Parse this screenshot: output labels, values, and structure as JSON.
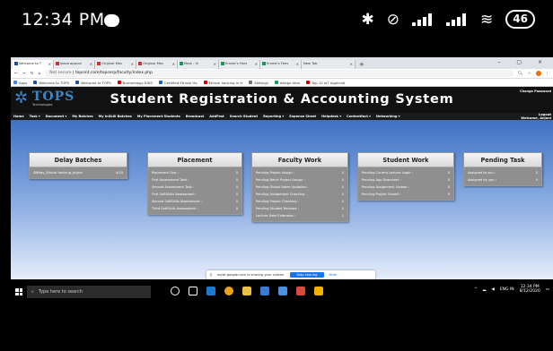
{
  "phone": {
    "time": "12:34 PM",
    "battery": "46"
  },
  "browser": {
    "tabs": [
      "Welcome to T",
      "leave approv",
      "Original Mes",
      "Original Mes",
      "Mast - Vi",
      "Ernest's Fees",
      "Ernest's Fees",
      "New Tab"
    ],
    "window_controls": "– ▢ ×",
    "url_prefix": "Not secure",
    "url": "topsint.com/topserp/faculty/index.php",
    "bookmarks": [
      "Apps",
      "Welcome to TOPS",
      "Welcome to TOPS",
      "Numerology KIDS",
      "Certified Ethical Ha",
      "Ethical hacking in H",
      "Settings",
      "design.html",
      "Top 10 IoT Applicati"
    ]
  },
  "site": {
    "logo_text": "TOPS",
    "logo_sub": "Technologies",
    "title": "Student Registration & Accounting System",
    "change_password": "Change Password",
    "welcome": "Welcome, Anjani",
    "nav": [
      "Home",
      "Task ▾",
      "Document ▾",
      "My Batches",
      "My InSkill Batches",
      "My Placement Students",
      "Broadcast",
      "AddFest",
      "Search Student",
      "Reporting ▾",
      "Expense Sheet",
      "Helpdesk ▾",
      "Contentfact ▾",
      "Networking ▾",
      "Logout"
    ]
  },
  "cards": {
    "delay": {
      "title": "Delay Batches",
      "rows": [
        {
          "label": "SMNay_Ethical Hacking_Anjani",
          "value": "4/10"
        }
      ]
    },
    "placement": {
      "title": "Placement",
      "rows": [
        {
          "label": "Placement Due :",
          "value": "0"
        },
        {
          "label": "First Assessment Task :",
          "value": "0"
        },
        {
          "label": "Second Assessment Task :",
          "value": "0"
        },
        {
          "label": "First SoftSkills Assessment :",
          "value": "0"
        },
        {
          "label": "Second SoftSkills Assessment :",
          "value": "0"
        },
        {
          "label": "Third SoftSkills Assessment :",
          "value": "0"
        }
      ]
    },
    "faculty": {
      "title": "Faculty Work",
      "rows": [
        {
          "label": "Pending Project Assign :",
          "value": "0"
        },
        {
          "label": "Pending Batch Project Assign :",
          "value": "0"
        },
        {
          "label": "Pending Global Notes Updation :",
          "value": "0"
        },
        {
          "label": "Pending Assignment Checking :",
          "value": "0"
        },
        {
          "label": "Pending Project Checking :",
          "value": "0"
        },
        {
          "label": "Pending Student Reviews :",
          "value": "0"
        },
        {
          "label": "Lecture Date Extension :",
          "value": "1"
        }
      ]
    },
    "student": {
      "title": "Student Work",
      "rows": [
        {
          "label": "Pending Current Lecture Login :",
          "value": "0"
        },
        {
          "label": "Pending App Download :",
          "value": "0"
        },
        {
          "label": "Pending Assignment Upload :",
          "value": "0"
        },
        {
          "label": "Pending Project Submit :",
          "value": "0"
        }
      ]
    },
    "pending": {
      "title": "Pending Task",
      "rows": [
        {
          "label": "Assigned to you :",
          "value": "5"
        },
        {
          "label": "Assigned by you :",
          "value": "5"
        }
      ]
    }
  },
  "screen_share": {
    "text": "meet.google.com is sharing your screen.",
    "stop_label": "Stop sharing",
    "hide_label": "Hide"
  },
  "taskbar": {
    "search_placeholder": "Type here to search",
    "lang": "ENG IN",
    "time": "12:34 PM",
    "date": "8/12/2020"
  },
  "colors": {
    "content_top": "#3f72c4",
    "card_body": "#8f8f8f",
    "stop_button": "#1a73e8"
  }
}
